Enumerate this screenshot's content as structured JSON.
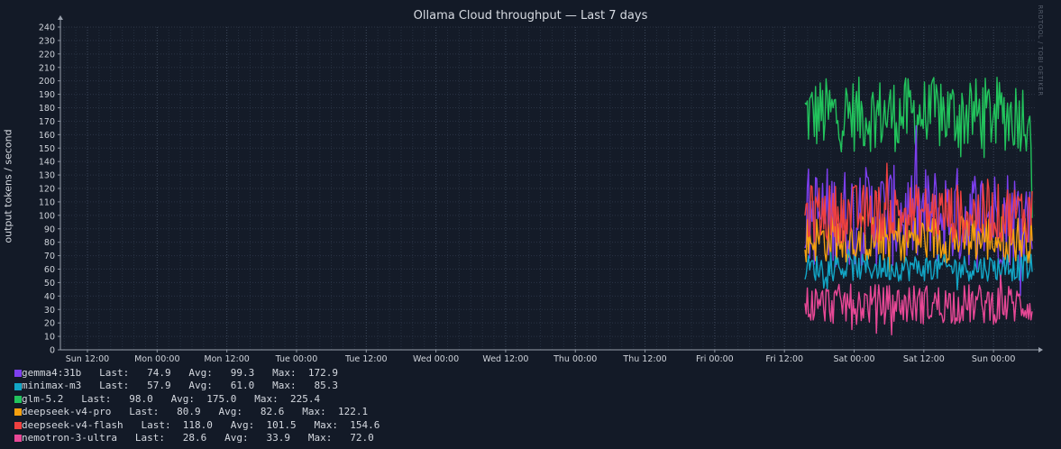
{
  "chart_data": {
    "type": "line",
    "title": "Ollama Cloud throughput — Last 7 days",
    "ylabel": "output tokens / second",
    "xlabel": "",
    "watermark": "RRDTOOL / TOBI OETIKER",
    "ylim": [
      0,
      240
    ],
    "y_ticks": [
      0,
      10,
      20,
      30,
      40,
      50,
      60,
      70,
      80,
      90,
      100,
      110,
      120,
      130,
      140,
      150,
      160,
      170,
      180,
      190,
      200,
      210,
      220,
      230,
      240
    ],
    "x_ticks": [
      "Sun 12:00",
      "Mon 00:00",
      "Mon 12:00",
      "Tue 00:00",
      "Tue 12:00",
      "Wed 00:00",
      "Wed 12:00",
      "Thu 00:00",
      "Thu 12:00",
      "Fri 00:00",
      "Fri 12:00",
      "Sat 00:00",
      "Sat 12:00",
      "Sun 00:00"
    ],
    "x_range": [
      "Sun 06:00",
      "Sun 09:00 (next)"
    ],
    "data_starts_at": "Fri 15:45",
    "grid": true,
    "legend_position": "bottom-left",
    "series": [
      {
        "name": "gemma4:31b",
        "color": "#7d3fef",
        "last": "74.9",
        "avg": "99.3",
        "max": "172.9"
      },
      {
        "name": "minimax-m3",
        "color": "#12a6c6",
        "last": "57.9",
        "avg": "61.0",
        "max": "85.3"
      },
      {
        "name": "glm-5.2",
        "color": "#22c35c",
        "last": "98.0",
        "avg": "175.0",
        "max": "225.4"
      },
      {
        "name": "deepseek-v4-pro",
        "color": "#f5a00f",
        "last": "80.9",
        "avg": "82.6",
        "max": "122.1"
      },
      {
        "name": "deepseek-v4-flash",
        "color": "#ee4040",
        "last": "118.0",
        "avg": "101.5",
        "max": "154.6"
      },
      {
        "name": "nemotron-3-ultra",
        "color": "#e84896",
        "last": "28.6",
        "avg": "33.9",
        "max": "72.0"
      }
    ]
  },
  "legend_labels": {
    "last": "Last:",
    "avg": "Avg:",
    "max": "Max:"
  }
}
